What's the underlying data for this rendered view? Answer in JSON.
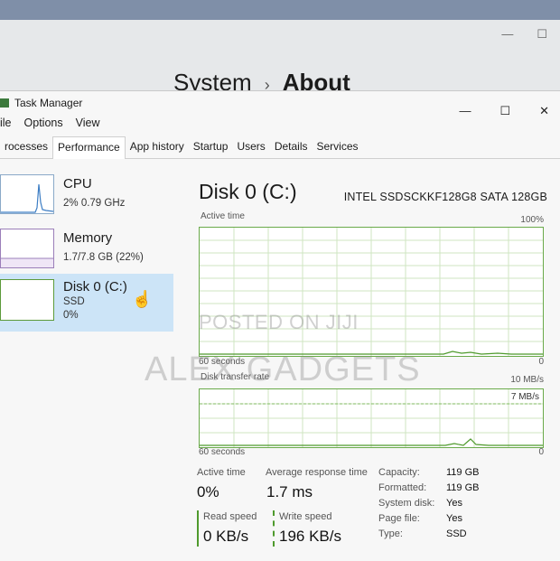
{
  "settings": {
    "breadcrumb_parent": "System",
    "breadcrumb_sep": "›",
    "breadcrumb_current": "About"
  },
  "window": {
    "title": "Task Manager",
    "minimize": "—",
    "maximize": "☐",
    "close": "✕"
  },
  "menu": [
    "ile",
    "Options",
    "View"
  ],
  "tabs": [
    "rocesses",
    "Performance",
    "App history",
    "Startup",
    "Users",
    "Details",
    "Services"
  ],
  "sidebar": [
    {
      "name": "CPU",
      "sub1": "2%  0.79 GHz"
    },
    {
      "name": "Memory",
      "sub1": "1.7/7.8 GB (22%)"
    },
    {
      "name": "Disk 0 (C:)",
      "sub1": "SSD",
      "sub2": "0%"
    }
  ],
  "disk": {
    "title": "Disk 0 (C:)",
    "model": "INTEL SSDSCKKF128G8 SATA 128GB",
    "active_time_label": "Active time",
    "active_time_max": "100%",
    "graph1_time": "60 seconds",
    "graph1_zero": "0",
    "transfer_label": "Disk transfer rate",
    "transfer_max": "10 MB/s",
    "transfer_mid": "7 MB/s",
    "graph2_time": "60 seconds",
    "graph2_zero": "0"
  },
  "watermark": {
    "line1": "POSTED ON JIJI",
    "line2": "ALEX GADGETS"
  },
  "stats": {
    "active_time_label": "Active time",
    "active_time": "0%",
    "avg_response_label": "Average response time",
    "avg_response": "1.7 ms",
    "read_label": "Read speed",
    "read": "0 KB/s",
    "write_label": "Write speed",
    "write": "196 KB/s"
  },
  "properties": [
    {
      "k": "Capacity:",
      "v": "119 GB"
    },
    {
      "k": "Formatted:",
      "v": "119 GB"
    },
    {
      "k": "System disk:",
      "v": "Yes"
    },
    {
      "k": "Page file:",
      "v": "Yes"
    },
    {
      "k": "Type:",
      "v": "SSD"
    }
  ],
  "colors": {
    "selected": "#cce4f7",
    "disk_green": "#6aaa4a",
    "accent_bar": "#4f9a2d"
  }
}
